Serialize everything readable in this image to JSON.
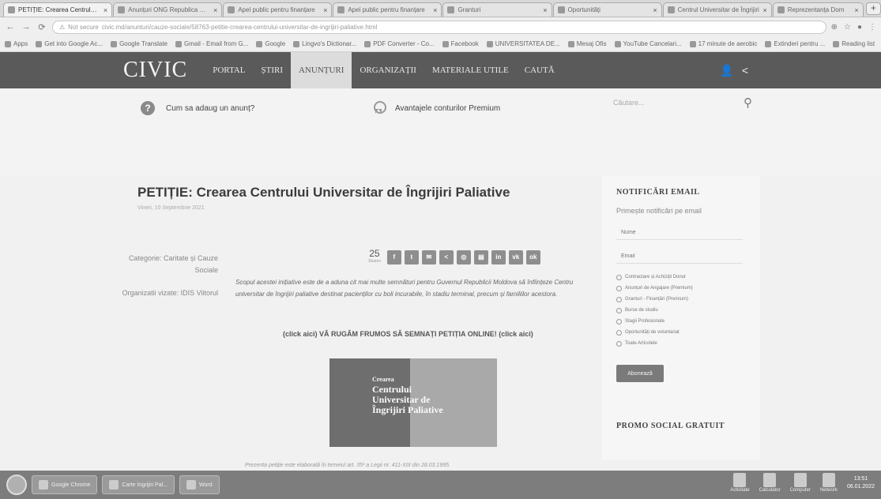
{
  "browser": {
    "tabs": [
      {
        "title": "PETIȚIE: Crearea Centrului Unive",
        "active": true
      },
      {
        "title": "Anunțuri ONG Republica Moldova",
        "active": false
      },
      {
        "title": "Apel public pentru finanțare",
        "active": false
      },
      {
        "title": "Apel public pentru finanțare",
        "active": false
      },
      {
        "title": "Granturi",
        "active": false
      },
      {
        "title": "Oportunități",
        "active": false
      },
      {
        "title": "Centrul Universitar de Îngrijiri",
        "active": false
      },
      {
        "title": "Reprezentanța Dom",
        "active": false
      }
    ],
    "new_tab": "+",
    "url": "civic.md/anunturi/cauze-sociale/58763-petitie-crearea-centrului-universitar-de-ingrijiri-paliative.html",
    "url_warning": "Not secure",
    "bookmarks": [
      "Apps",
      "Get into Google Ac...",
      "Google Translate",
      "Gmail - Email from G...",
      "Google",
      "Lingvo's Dictionar...",
      "PDF Converter - Co...",
      "Facebook",
      "UNIVERSITATEA DE...",
      "Mesaj Ofis",
      "YouTube Cancelari...",
      "17 minute de aerobic",
      "Extinderi pentru ...",
      "Reading list"
    ]
  },
  "site": {
    "logo": "CIVIC",
    "menu": [
      "PORTAL",
      "ȘTIRI",
      "ANUNȚURI",
      "ORGANIZAȚII",
      "MATERIALE UTILE",
      "CAUTĂ"
    ],
    "active_menu": "ANUNȚURI"
  },
  "infobar": {
    "help": "Cum sa adaug un anunț?",
    "premium": "Avantajele conturilor Premium",
    "search_placeholder": "Căutare..."
  },
  "article": {
    "title": "PETIȚIE: Crearea Centrului Universitar de Îngrijiri Paliative",
    "date": "Vineri, 10 Septembrie 2021",
    "category_label": "Categorie: Caritate și Cauze Sociale",
    "org_label": "Organizatii vizate: IDIS Viitorul",
    "share_count": "25",
    "share_label": "Shares",
    "intro": "Scopul acestei inițiative este de a aduna cit mai multe semnături pentru Guvernul Republicii Moldova să înființeze Centru universitar de îngrijiri paliative destinat pacienților cu boli incurabile, în stadiu terminal, precum și familiilor acestora.",
    "cta": "(click aici) VĂ RUGĂM FRUMOS SĂ SEMNAȚI PETIȚIA ONLINE! (click aici)",
    "poster_lines": [
      "Crearea",
      "Centrului",
      "Universitar de",
      "Îngrijiri Paliative"
    ],
    "footnote": "Prezenta petiție este elaborată în temeiul art. 35¹ a Legii nr. 411-XIII din 28.03.1995."
  },
  "sidebar": {
    "title": "NOTIFICĂRI EMAIL",
    "subtitle": "Primește notificări pe email",
    "name_placeholder": "Nume",
    "email_placeholder": "Email",
    "checks": [
      "Contractare și Achiziții Donor",
      "Anunțuri de Angajare (Premium)",
      "Granturi - Finanțări (Premium)",
      "Burse de studiu",
      "Stagii Profesionale",
      "Oportunități de voluntariat",
      "Toate Articolele"
    ],
    "subscribe": "Abonează",
    "promo_title": "PROMO SOCIAL GRATUIT"
  },
  "taskbar": {
    "tasks": [
      "Google Chrome",
      "Carte Ingrijiri Pal...",
      "Word"
    ],
    "tray": [
      "Activitate",
      "Calculator",
      "Computer",
      "Network"
    ],
    "time": "13:51",
    "date": "06.01.2022"
  }
}
